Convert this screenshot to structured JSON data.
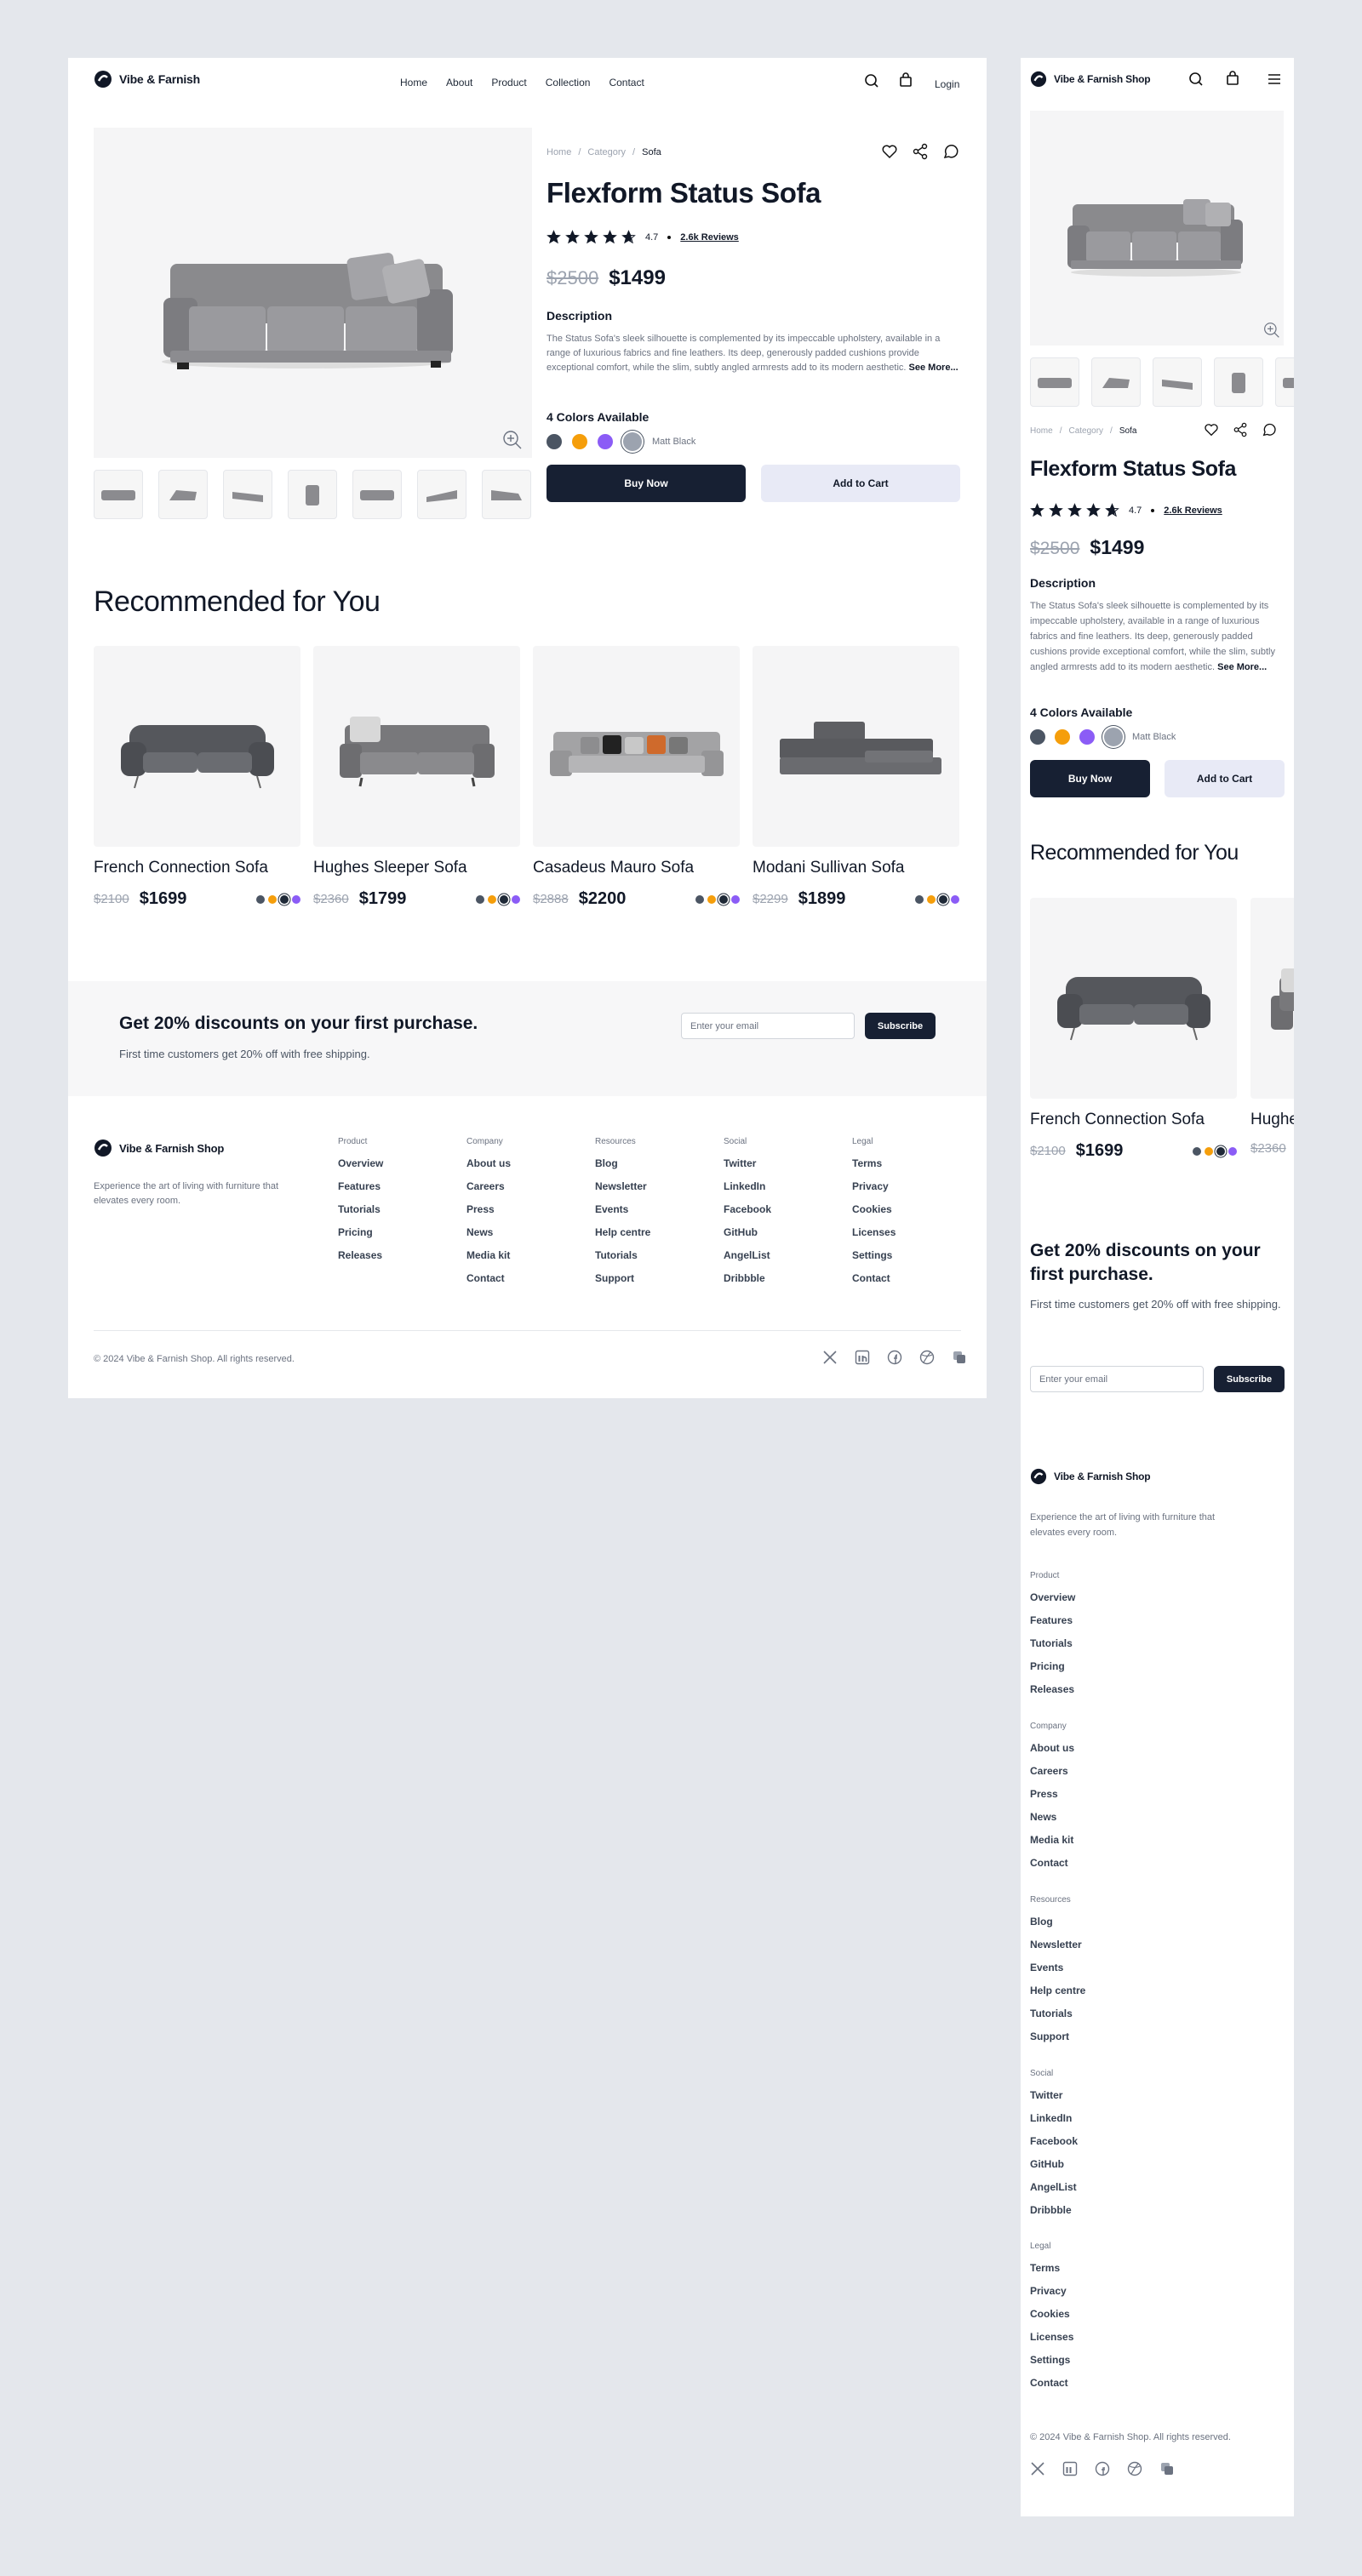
{
  "brand": {
    "name": "Vibe & Farnish",
    "name_full": "Vibe & Farnish Shop"
  },
  "nav": {
    "home": "Home",
    "about": "About",
    "product": "Product",
    "collection": "Collection",
    "contact": "Contact",
    "login": "Login"
  },
  "breadcrumb": {
    "home": "Home",
    "category": "Category",
    "current": "Sofa",
    "sep": "/"
  },
  "product": {
    "title": "Flexform Status Sofa",
    "rating": "4.7",
    "rating_value": 4.7,
    "reviews": "2.6k Reviews",
    "old_price": "$2500",
    "price": "$1499",
    "desc_heading": "Description",
    "description": "The Status Sofa's sleek silhouette is complemented by its impeccable upholstery, available in a range of luxurious fabrics and fine leathers. Its deep, generously padded cushions provide exceptional comfort, while the slim, subtly angled armrests add to its modern aesthetic.",
    "see_more": "See More...",
    "colors_heading": "4 Colors Available",
    "color_selected": "Matt Black",
    "colors": [
      "#4b5563",
      "#f59e0b",
      "#8b5cf6",
      "#9ca3af"
    ],
    "buy_now": "Buy Now",
    "add_to_cart": "Add to Cart"
  },
  "recommended": {
    "title": "Recommended for You",
    "items": [
      {
        "name": "French Connection Sofa",
        "old": "$2100",
        "price": "$1699"
      },
      {
        "name": "Hughes Sleeper Sofa",
        "old": "$2360",
        "price": "$1799"
      },
      {
        "name": "Casadeus Mauro Sofa",
        "old": "$2888",
        "price": "$2200"
      },
      {
        "name": "Modani Sullivan Sofa",
        "old": "$2299",
        "price": "$1899"
      }
    ],
    "swatches": [
      "#4b5563",
      "#f59e0b",
      "#1f2937",
      "#8b5cf6"
    ]
  },
  "promo": {
    "title": "Get 20% discounts on your first purchase.",
    "subtitle": "First time customers get 20% off with free shipping.",
    "placeholder": "Enter your email",
    "button": "Subscribe"
  },
  "footer": {
    "tagline": "Experience the art of living with furniture that elevates every room.",
    "columns": [
      {
        "heading": "Product",
        "links": [
          "Overview",
          "Features",
          "Tutorials",
          "Pricing",
          "Releases"
        ]
      },
      {
        "heading": "Company",
        "links": [
          "About us",
          "Careers",
          "Press",
          "News",
          "Media kit",
          "Contact"
        ]
      },
      {
        "heading": "Resources",
        "links": [
          "Blog",
          "Newsletter",
          "Events",
          "Help centre",
          "Tutorials",
          "Support"
        ]
      },
      {
        "heading": "Social",
        "links": [
          "Twitter",
          "LinkedIn",
          "Facebook",
          "GitHub",
          "AngelList",
          "Dribbble"
        ]
      },
      {
        "heading": "Legal",
        "links": [
          "Terms",
          "Privacy",
          "Cookies",
          "Licenses",
          "Settings",
          "Contact"
        ]
      }
    ],
    "copyright": "© 2024 Vibe & Farnish Shop. All rights reserved."
  },
  "icons": [
    "logo-icon",
    "search-icon",
    "bag-icon",
    "menu-icon",
    "heart-icon",
    "share-icon",
    "chat-icon",
    "zoom-in-icon",
    "star-icon",
    "x-twitter-icon",
    "linkedin-icon",
    "facebook-icon",
    "dribbble-icon",
    "layers-icon"
  ]
}
